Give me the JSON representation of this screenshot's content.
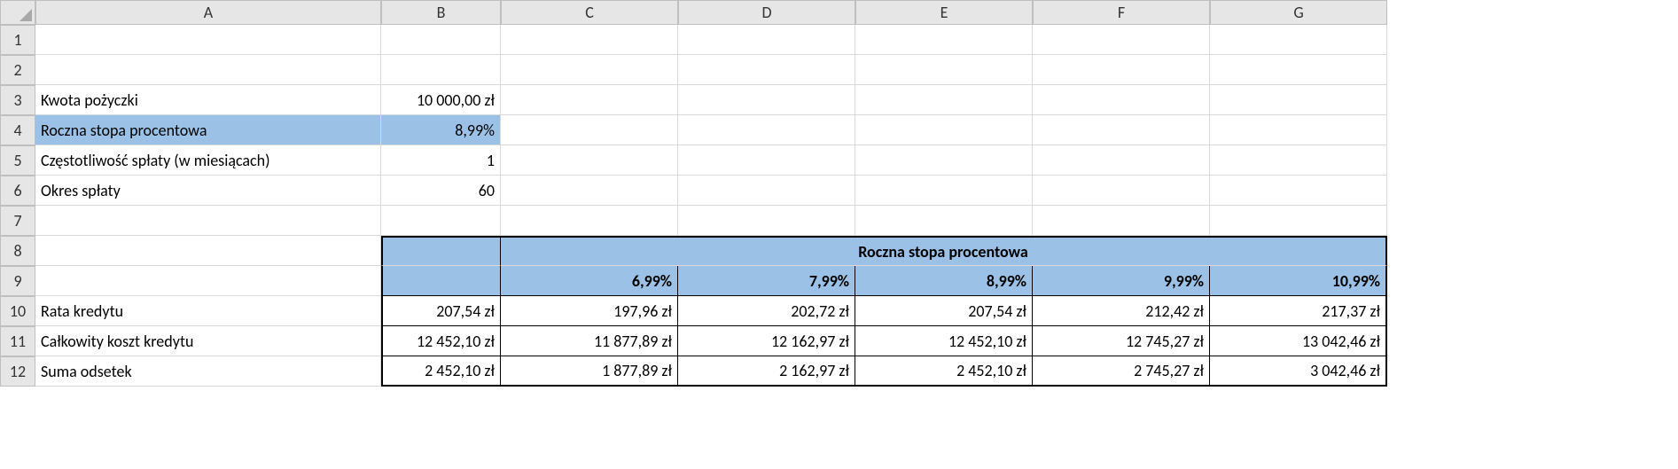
{
  "columns": [
    "A",
    "B",
    "C",
    "D",
    "E",
    "F",
    "G"
  ],
  "rows": [
    "1",
    "2",
    "3",
    "4",
    "5",
    "6",
    "7",
    "8",
    "9",
    "10",
    "11",
    "12"
  ],
  "params": {
    "loan_amount_label": "Kwota pożyczki",
    "loan_amount_value": "10 000,00 zł",
    "rate_label": "Roczna stopa procentowa",
    "rate_value": "8,99%",
    "freq_label": "Częstotliwość spłaty (w miesiącach)",
    "freq_value": "1",
    "period_label": "Okres spłaty",
    "period_value": "60"
  },
  "table": {
    "header_title": "Roczna stopa procentowa",
    "col_rates": [
      "6,99%",
      "7,99%",
      "8,99%",
      "9,99%",
      "10,99%"
    ],
    "rows": [
      {
        "label": "Rata kredytu",
        "base": "207,54 zł",
        "vals": [
          "197,96 zł",
          "202,72 zł",
          "207,54 zł",
          "212,42 zł",
          "217,37 zł"
        ]
      },
      {
        "label": "Całkowity koszt kredytu",
        "base": "12 452,10 zł",
        "vals": [
          "11 877,89 zł",
          "12 162,97 zł",
          "12 452,10 zł",
          "12 745,27 zł",
          "13 042,46 zł"
        ]
      },
      {
        "label": "Suma odsetek",
        "base": "2 452,10 zł",
        "vals": [
          "1 877,89 zł",
          "2 162,97 zł",
          "2 452,10 zł",
          "2 745,27 zł",
          "3 042,46 zł"
        ]
      }
    ]
  }
}
